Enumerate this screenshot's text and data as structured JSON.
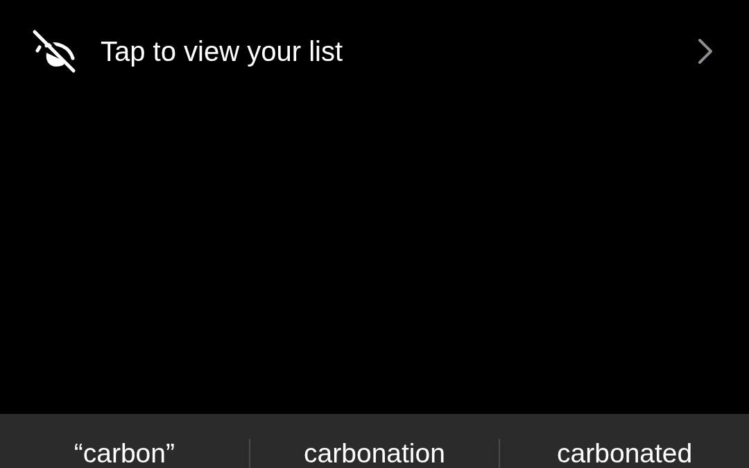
{
  "list_row": {
    "label": "Tap to view your list",
    "hidden": true
  },
  "suggestions": [
    {
      "label": "“carbon”"
    },
    {
      "label": "carbonation"
    },
    {
      "label": "carbonated"
    }
  ]
}
